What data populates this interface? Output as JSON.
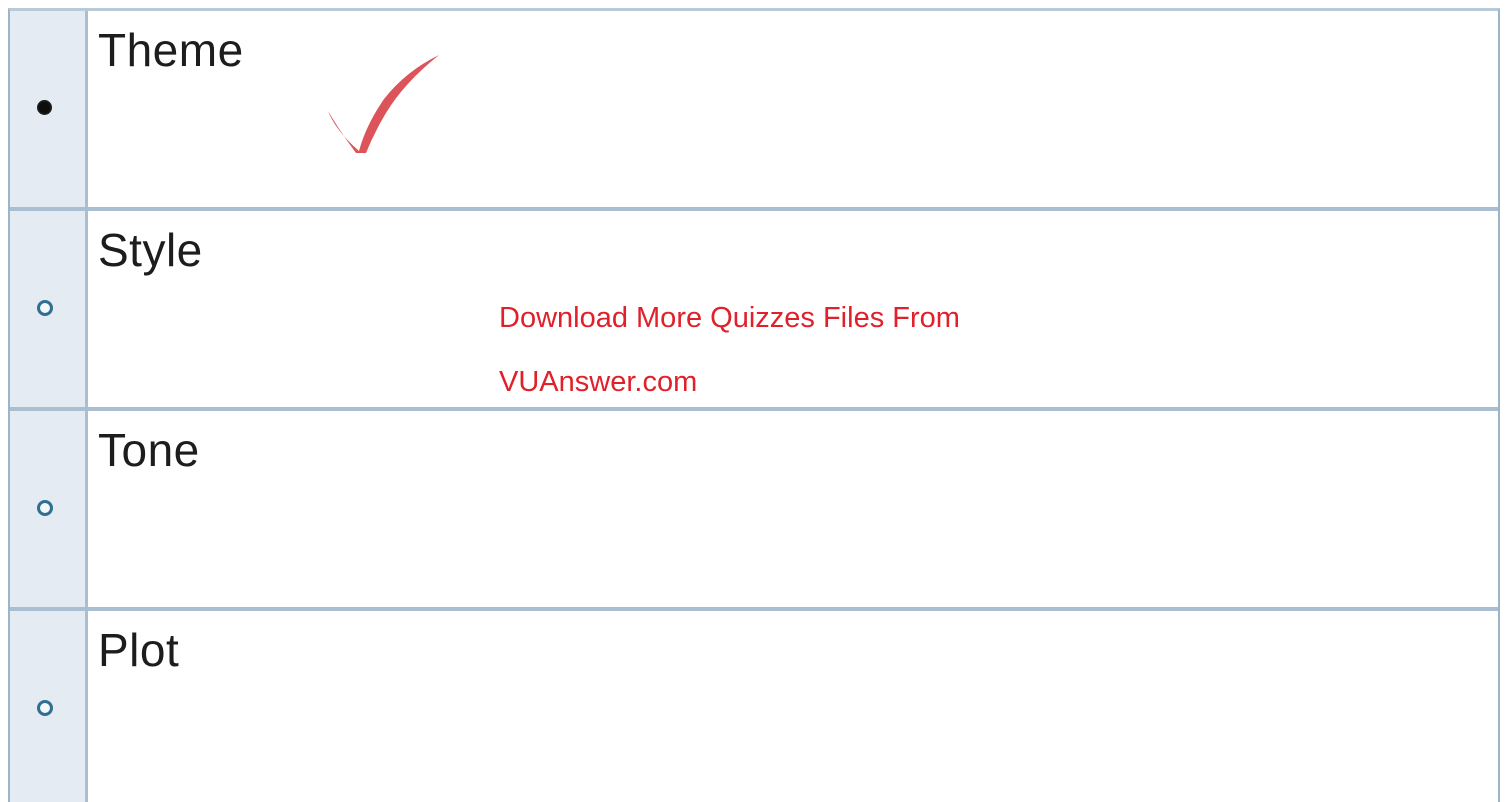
{
  "options": [
    {
      "label": "Theme",
      "selected": true
    },
    {
      "label": "Style",
      "selected": false
    },
    {
      "label": "Tone",
      "selected": false
    },
    {
      "label": "Plot",
      "selected": false
    }
  ],
  "correct_mark": {
    "icon": "checkmark-icon",
    "color": "#d9454c"
  },
  "watermark": {
    "line1": "Download More Quizzes Files From",
    "line2": "VUAnswer.com",
    "color": "#e0202a"
  }
}
